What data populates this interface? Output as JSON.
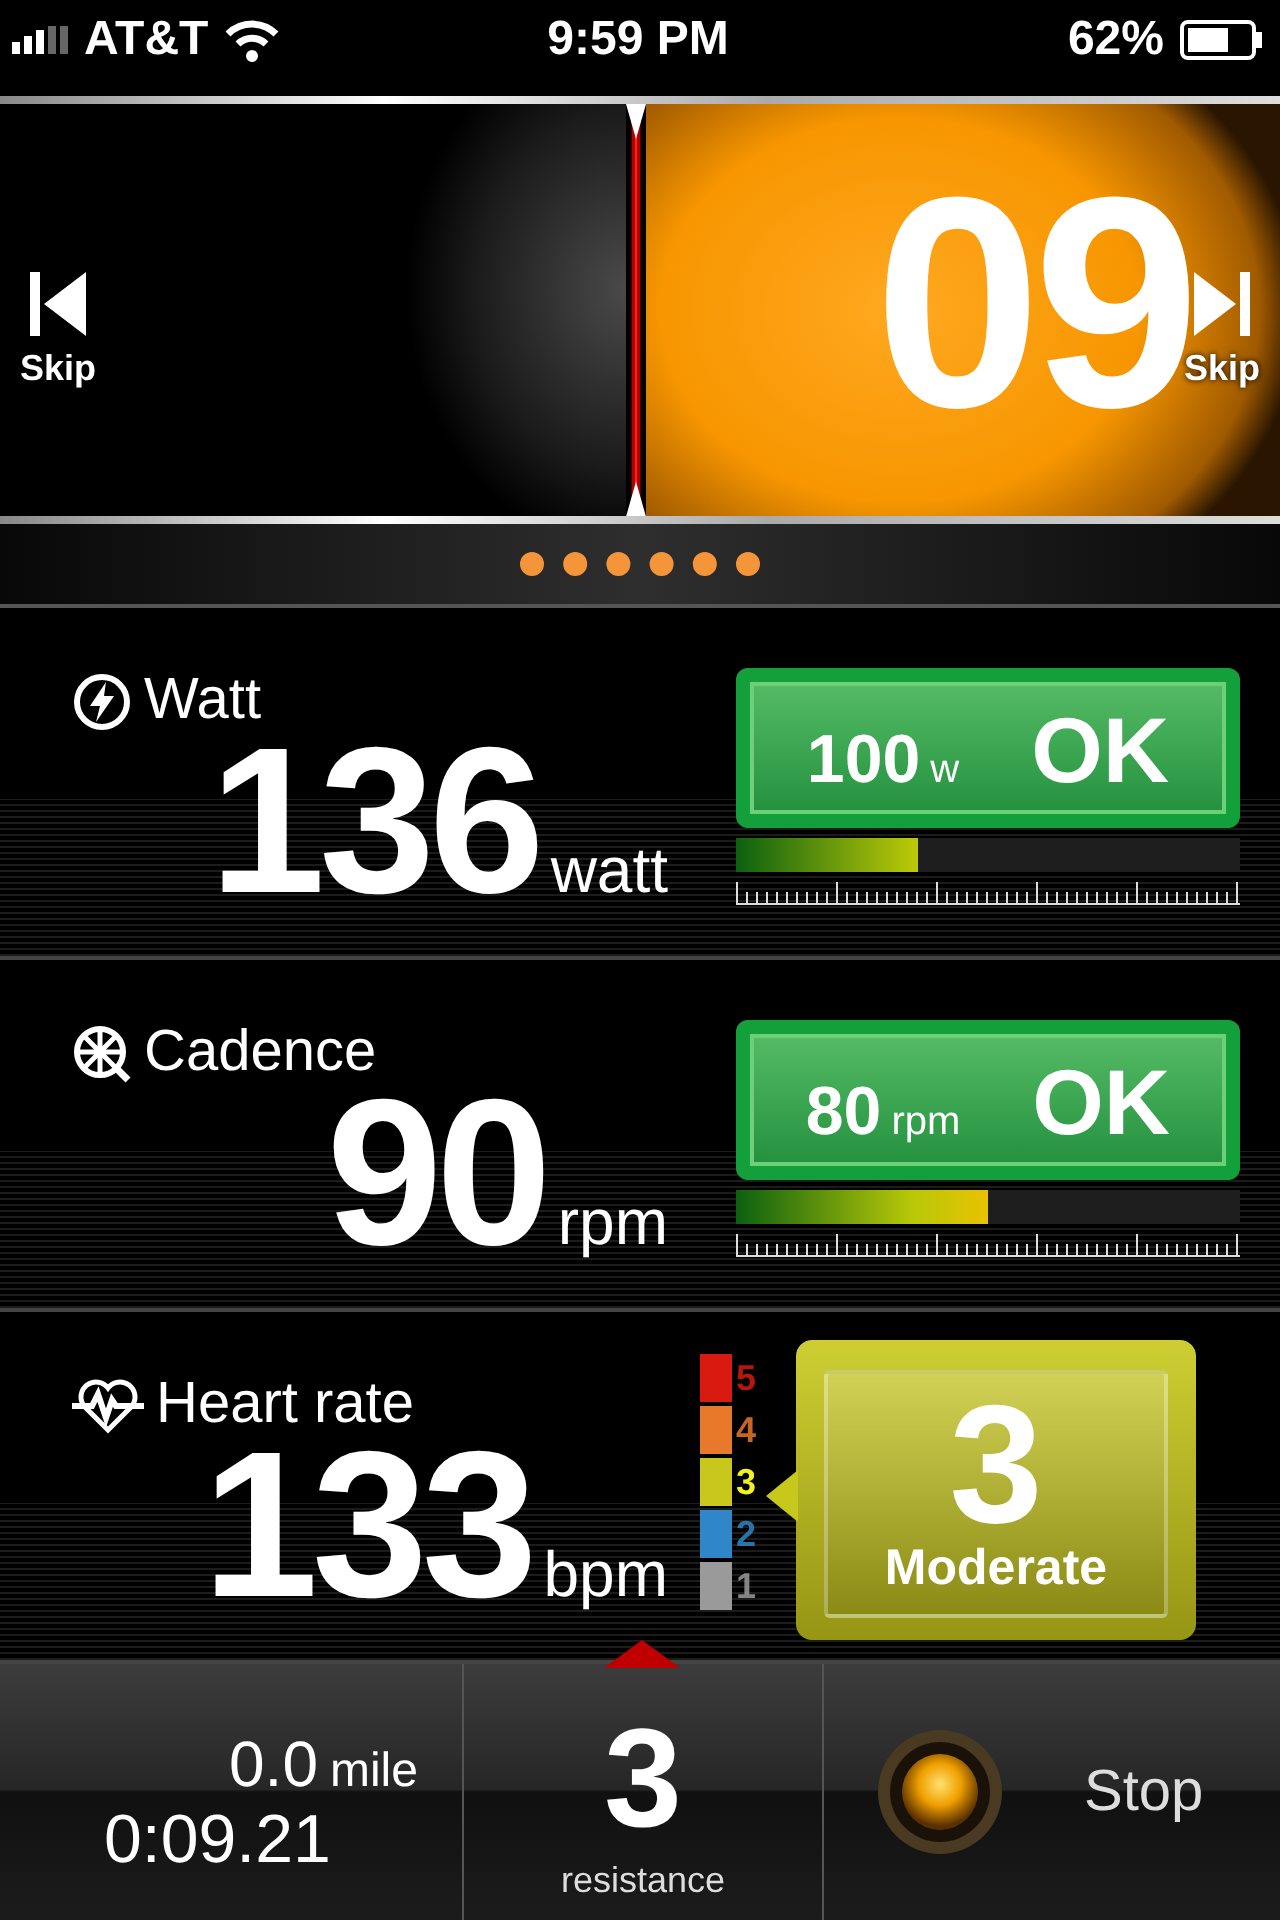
{
  "status_bar": {
    "carrier": "AT&T",
    "time": "9:59 PM",
    "battery": "62%"
  },
  "interval": {
    "skip_back": "Skip",
    "skip_forward": "Skip",
    "countdown": "09"
  },
  "metrics": [
    {
      "kind": "target",
      "label": "Watt",
      "value": "136",
      "unit": "watt",
      "target_value": "100",
      "target_unit": "w",
      "status": "OK",
      "level": 0.36
    },
    {
      "kind": "target",
      "label": "Cadence",
      "value": "90",
      "unit": "rpm",
      "target_value": "80",
      "target_unit": "rpm",
      "status": "OK",
      "level": 0.5
    },
    {
      "kind": "zone",
      "label": "Heart rate",
      "value": "133",
      "unit": "bpm",
      "zone_value": "3",
      "zone_name": "Moderate",
      "zones": [
        {
          "label": "5",
          "color": "#d81a10",
          "selected": false
        },
        {
          "label": "4",
          "color": "#e8782a",
          "selected": false
        },
        {
          "label": "3",
          "color": "#c8c81c",
          "selected": true
        },
        {
          "label": "2",
          "color": "#2f86c8",
          "selected": false
        },
        {
          "label": "1",
          "color": "#9a9a9a",
          "selected": false
        }
      ]
    }
  ],
  "footer": {
    "distance": "0.0",
    "distance_unit": "mile",
    "elapsed": "0:09.21",
    "resistance": "3",
    "resistance_label": "resistance",
    "stop": "Stop"
  }
}
